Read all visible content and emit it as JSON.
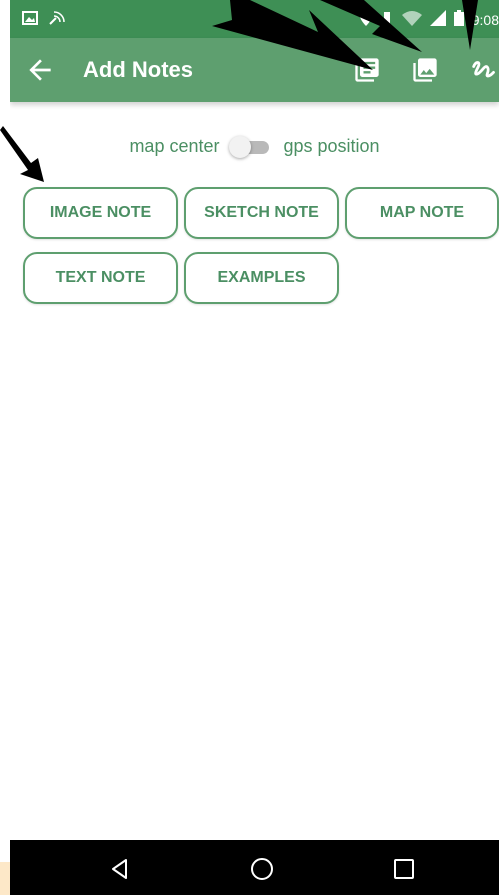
{
  "statusbar": {
    "time": "9:08"
  },
  "appbar": {
    "title": "Add Notes"
  },
  "toggle": {
    "left_label": "map center",
    "right_label": "gps position"
  },
  "buttons": {
    "image_note": "IMAGE NOTE",
    "sketch_note": "SKETCH NOTE",
    "map_note": "MAP NOTE",
    "text_note": "TEXT NOTE",
    "examples": "EXAMPLES"
  },
  "colors": {
    "statusbar": "#3e8f55",
    "appbar": "#5e9f6f",
    "accent_text": "#4b8f63",
    "navbar": "#000000"
  },
  "icons": [
    "back-arrow-icon",
    "notes-list-icon",
    "image-icon",
    "sketch-icon",
    "back-triangle-icon",
    "home-circle-icon",
    "recents-square-icon"
  ]
}
